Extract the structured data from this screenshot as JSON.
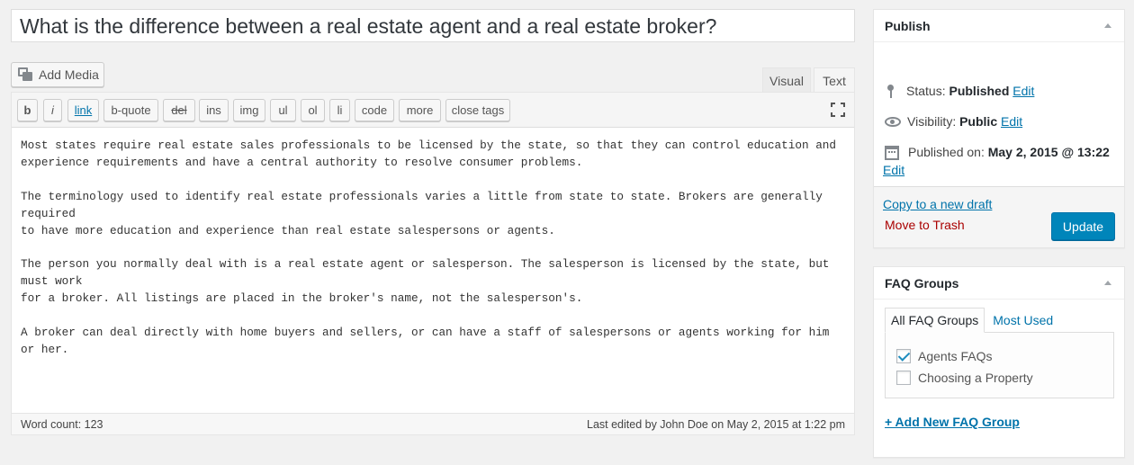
{
  "post": {
    "title": "What is the difference between a real estate agent and a real estate broker?",
    "content": [
      "Most states require real estate sales professionals to be licensed by the state, so that they can control education and\nexperience requirements and have a central authority to resolve consumer problems.",
      "The terminology used to identify real estate professionals varies a little from state to state. Brokers are generally required\nto have more education and experience than real estate salespersons or agents.",
      "The person you normally deal with is a real estate agent or salesperson. The salesperson is licensed by the state, but must work\nfor a broker. All listings are placed in the broker's name, not the salesperson's.",
      "A broker can deal directly with home buyers and sellers, or can have a staff of salespersons or agents working for him or her."
    ]
  },
  "editor": {
    "add_media_label": "Add Media",
    "tabs": {
      "visual": "Visual",
      "text": "Text"
    },
    "quicktags": [
      "b",
      "i",
      "link",
      "b-quote",
      "del",
      "ins",
      "img",
      "ul",
      "ol",
      "li",
      "code",
      "more",
      "close tags"
    ],
    "word_count": "Word count: 123",
    "last_edited": "Last edited by John Doe on May 2, 2015 at 1:22 pm"
  },
  "publish": {
    "heading": "Publish",
    "status_label": "Status:",
    "status_value": "Published",
    "visibility_label": "Visibility:",
    "visibility_value": "Public",
    "published_on_label": "Published on:",
    "published_on_value": "May 2, 2015 @ 13:22",
    "edit_label": "Edit",
    "copy_draft": "Copy to a new draft",
    "trash": "Move to Trash",
    "update": "Update"
  },
  "faq_groups": {
    "heading": "FAQ Groups",
    "tab_all": "All FAQ Groups",
    "tab_most_used": "Most Used",
    "items": [
      {
        "label": "Agents FAQs",
        "checked": true
      },
      {
        "label": "Choosing a Property",
        "checked": false
      }
    ],
    "add_new": "+ Add New FAQ Group"
  },
  "colors": {
    "link": "#0073aa",
    "primary_button": "#0085ba",
    "trash": "#a00"
  },
  "icons": [
    "media-icon",
    "fullscreen-icon",
    "pin-icon",
    "eye-icon",
    "calendar-icon",
    "toggle-arrow-icon",
    "checkmark-icon"
  ]
}
